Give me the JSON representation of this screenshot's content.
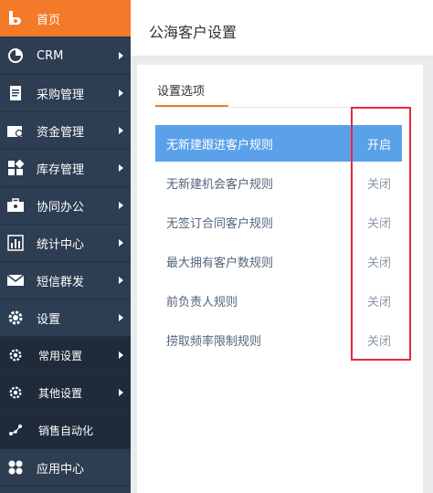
{
  "sidebar": {
    "items": [
      {
        "label": "首页",
        "icon": "home-icon"
      },
      {
        "label": "CRM",
        "icon": "pie-chart-icon"
      },
      {
        "label": "采购管理",
        "icon": "document-icon"
      },
      {
        "label": "资金管理",
        "icon": "wallet-icon"
      },
      {
        "label": "库存管理",
        "icon": "grid-icon"
      },
      {
        "label": "协同办公",
        "icon": "briefcase-icon"
      },
      {
        "label": "统计中心",
        "icon": "bar-chart-icon"
      },
      {
        "label": "短信群发",
        "icon": "envelope-icon"
      },
      {
        "label": "设置",
        "icon": "gear-icon"
      },
      {
        "label": "常用设置",
        "icon": "gear-icon"
      },
      {
        "label": "其他设置",
        "icon": "gear-icon"
      },
      {
        "label": "销售自动化",
        "icon": "share-icon"
      },
      {
        "label": "应用中心",
        "icon": "apps-icon"
      }
    ]
  },
  "header": {
    "title": "公海客户设置"
  },
  "panel": {
    "tab_label": "设置选项",
    "rules": [
      {
        "name": "无新建跟进客户规则",
        "status": "开启"
      },
      {
        "name": "无新建机会客户规则",
        "status": "关闭"
      },
      {
        "name": "无签订合同客户规则",
        "status": "关闭"
      },
      {
        "name": "最大拥有客户数规则",
        "status": "关闭"
      },
      {
        "name": "前负责人规则",
        "status": "关闭"
      },
      {
        "name": "捞取频率限制规则",
        "status": "关闭"
      }
    ]
  },
  "colors": {
    "accent": "#f47a2a",
    "sidebar_bg": "#2d3d52",
    "active_row": "#5aa1ea",
    "annotation": "#e8283a"
  }
}
